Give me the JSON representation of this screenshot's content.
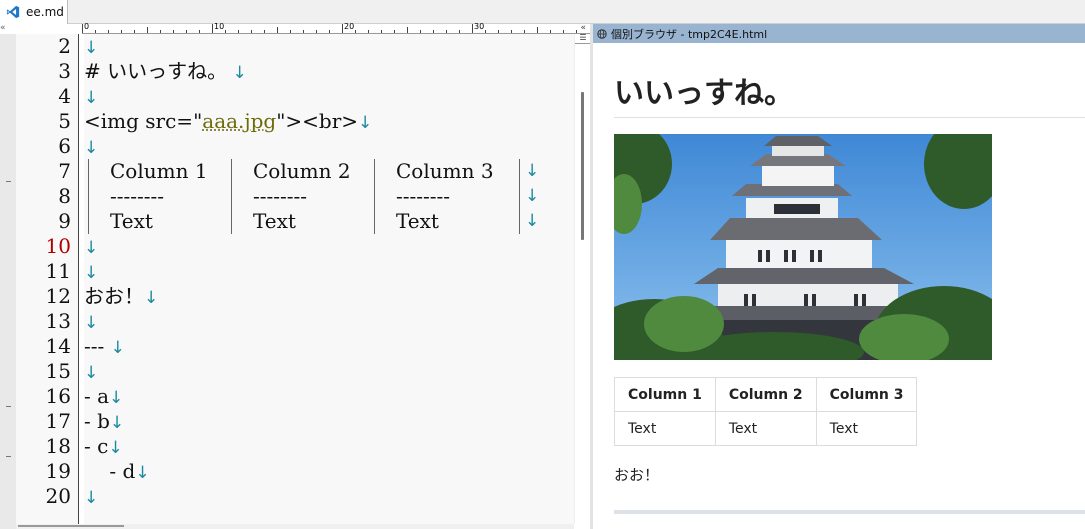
{
  "tab": {
    "title": "ee.md"
  },
  "ruler": {
    "marks": [
      "0",
      "10",
      "20",
      "30"
    ]
  },
  "editor": {
    "lines": [
      {
        "num": "2"
      },
      {
        "num": "3",
        "text": "# いいっすね。"
      },
      {
        "num": "4"
      },
      {
        "num": "5",
        "pre": "<img src=\"",
        "link": "aaa.jpg",
        "post": "\"><br>"
      },
      {
        "num": "6"
      },
      {
        "num": "7",
        "cells": [
          "Column 1",
          "Column 2",
          "Column 3"
        ]
      },
      {
        "num": "8",
        "cells": [
          "--------",
          "--------",
          "--------"
        ]
      },
      {
        "num": "9",
        "cells": [
          "Text",
          "Text",
          "Text"
        ]
      },
      {
        "num": "10"
      },
      {
        "num": "11"
      },
      {
        "num": "12",
        "text": "おお！"
      },
      {
        "num": "13"
      },
      {
        "num": "14",
        "text": "--- "
      },
      {
        "num": "15"
      },
      {
        "num": "16",
        "text": "- a"
      },
      {
        "num": "17",
        "text": "- b"
      },
      {
        "num": "18",
        "text": "- c"
      },
      {
        "num": "19",
        "text": "    - d"
      },
      {
        "num": "20"
      }
    ],
    "newline_glyph": "↓",
    "current_line": "10"
  },
  "preview": {
    "window_title": "個別ブラウザ - tmp2C4E.html",
    "heading": "いいっすね。",
    "table": {
      "headers": [
        "Column 1",
        "Column 2",
        "Column 3"
      ],
      "rows": [
        [
          "Text",
          "Text",
          "Text"
        ]
      ]
    },
    "paragraph": "おお！"
  }
}
